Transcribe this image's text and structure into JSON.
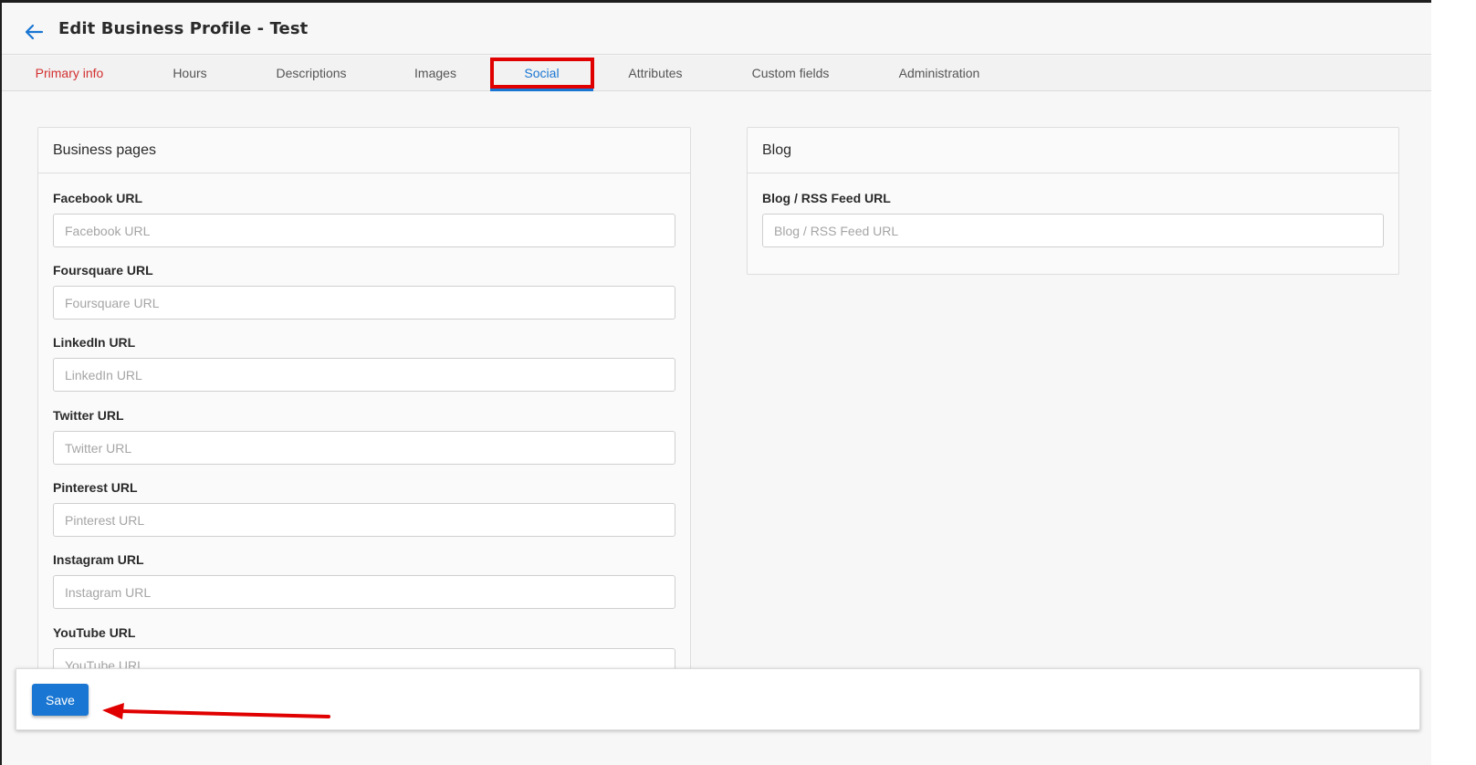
{
  "header": {
    "title": "Edit Business Profile - Test",
    "back_icon": "arrow-left-icon",
    "accent": "#1976d2"
  },
  "tabs": [
    {
      "label": "Primary info",
      "state": "error"
    },
    {
      "label": "Hours",
      "state": "normal"
    },
    {
      "label": "Descriptions",
      "state": "normal"
    },
    {
      "label": "Images",
      "state": "normal"
    },
    {
      "label": "Social",
      "state": "active"
    },
    {
      "label": "Attributes",
      "state": "normal"
    },
    {
      "label": "Custom fields",
      "state": "normal"
    },
    {
      "label": "Administration",
      "state": "normal"
    }
  ],
  "business_pages": {
    "title": "Business pages",
    "fields": [
      {
        "label": "Facebook URL",
        "placeholder": "Facebook URL"
      },
      {
        "label": "Foursquare URL",
        "placeholder": "Foursquare URL"
      },
      {
        "label": "LinkedIn URL",
        "placeholder": "LinkedIn URL"
      },
      {
        "label": "Twitter URL",
        "placeholder": "Twitter URL"
      },
      {
        "label": "Pinterest URL",
        "placeholder": "Pinterest URL"
      },
      {
        "label": "Instagram URL",
        "placeholder": "Instagram URL"
      },
      {
        "label": "YouTube URL",
        "placeholder": "YouTube URL"
      }
    ]
  },
  "blog": {
    "title": "Blog",
    "fields": [
      {
        "label": "Blog / RSS Feed URL",
        "placeholder": "Blog / RSS Feed URL"
      }
    ]
  },
  "footer": {
    "save_label": "Save",
    "button_color": "#1976d2"
  },
  "annotations": {
    "highlight_color": "#e00000"
  }
}
